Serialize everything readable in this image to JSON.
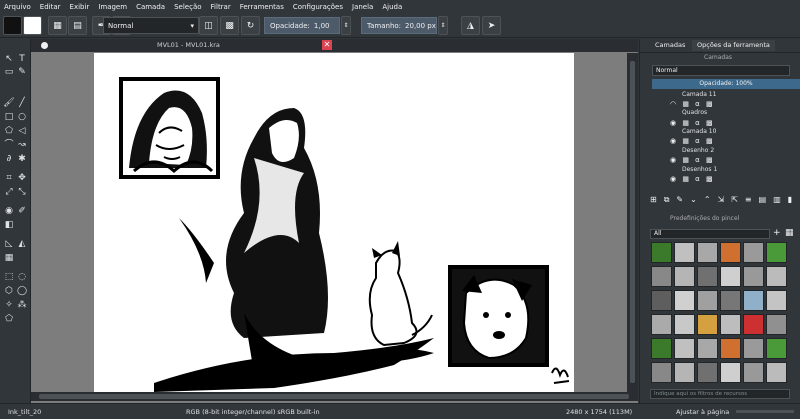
{
  "menu": [
    "Arquivo",
    "Editar",
    "Exibir",
    "Imagem",
    "Camada",
    "Seleção",
    "Filtrar",
    "Ferramentas",
    "Configurações",
    "Janela",
    "Ajuda"
  ],
  "toolbar": {
    "blend_mode": "Normal",
    "opacity_label": "Opacidade:",
    "opacity_value": "1,00",
    "size_label": "Tamanho:",
    "size_value": "20,00 px"
  },
  "document": {
    "tab_title": "MVL01 - MVL01.kra",
    "close_glyph": "✕"
  },
  "right_panel": {
    "tabs": [
      "Camadas",
      "Opções da ferramenta"
    ],
    "layers_title": "Camadas",
    "blend_mode": "Normal",
    "opacity": "Opacidade:  100%",
    "layers": [
      {
        "name": "Camada 11"
      },
      {
        "name": "Quadros"
      },
      {
        "name": "Camada 10"
      },
      {
        "name": "Desenho 2"
      },
      {
        "name": "Desenhos 1"
      }
    ],
    "presets_title": "Predefinições do pincel",
    "presets_filter": "All",
    "tag_search_placeholder": "Indique aqui os filtros de recursos"
  },
  "status": {
    "brush": "Ink_tilt_20",
    "color_model": "RGB (8-bit integer/channel)  sRGB built-in",
    "image_size": "2480 x 1754 (113M)",
    "zoom": "Ajustar à página"
  },
  "colors": {
    "chrome": "#31363b",
    "accent": "#3daee9",
    "canvas_bg": "#7d7d7d",
    "close_red": "#da4453"
  }
}
